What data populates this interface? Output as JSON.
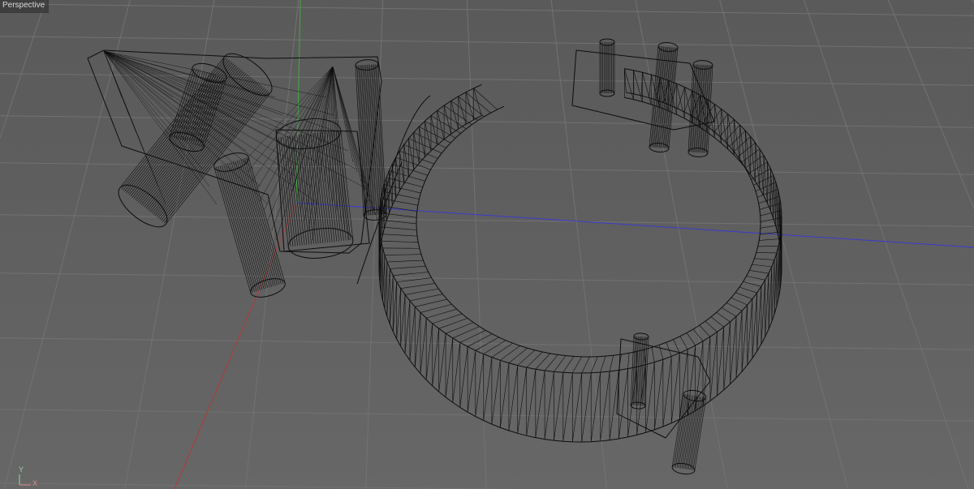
{
  "viewport": {
    "label": "Perspective"
  },
  "axis_gizmo": {
    "y_label": "Y",
    "x_label": "X"
  },
  "colors": {
    "background": "#5b5b5b",
    "grid_line": "#6f6f6f",
    "wireframe": "#0d0d0d",
    "world_x_axis": "#b33a3a",
    "world_y_axis": "#3fae3f",
    "world_z_axis": "#3a3ad0"
  },
  "icons": {
    "model": "wireframe-mesh",
    "gizmo": "axis-gizmo-icon"
  }
}
